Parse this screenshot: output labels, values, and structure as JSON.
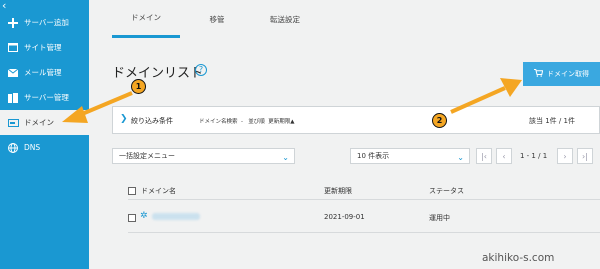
{
  "sidebar": {
    "collapse_glyph": "‹",
    "items": [
      {
        "label": "サーバー追加",
        "icon": "plus-icon"
      },
      {
        "label": "サイト管理",
        "icon": "window-icon"
      },
      {
        "label": "メール管理",
        "icon": "mail-icon"
      },
      {
        "label": "サーバー管理",
        "icon": "server-icon"
      },
      {
        "label": "ドメイン",
        "icon": "domain-icon"
      },
      {
        "label": "DNS",
        "icon": "globe-icon"
      }
    ]
  },
  "tabs": [
    {
      "label": "ドメイン"
    },
    {
      "label": "移管"
    },
    {
      "label": "転送設定"
    }
  ],
  "page": {
    "title": "ドメインリスト",
    "help_glyph": "?",
    "acquire_button": "ドメイン取得"
  },
  "filter": {
    "label": "絞り込み条件",
    "search_label": "ドメイン名検索",
    "search_value": "-",
    "sort_label": "並び順",
    "sort_value": "更新期限▲",
    "count": "該当 1件 / 1件"
  },
  "controls": {
    "bulk_select": "一括設定メニュー",
    "per_page": "10 件表示",
    "page_info": "1 - 1 / 1"
  },
  "table": {
    "headers": [
      "ドメイン名",
      "更新期限",
      "ステータス"
    ],
    "rows": [
      {
        "expiry": "2021-09-01",
        "status": "運用中"
      }
    ]
  },
  "annotations": {
    "badge1": "1",
    "badge2": "2",
    "arrow_color": "#f4a623"
  },
  "watermark": "akihiko-s.com"
}
